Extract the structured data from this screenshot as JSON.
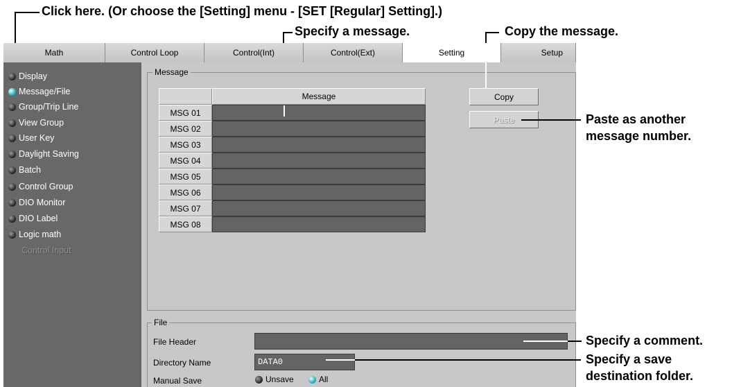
{
  "callouts": {
    "click_here": "Click here. (Or choose the [Setting] menu - [SET [Regular] Setting].)",
    "specify_message": "Specify a message.",
    "copy_message": "Copy the message.",
    "paste_line1": "Paste as another",
    "paste_line2": "message number.",
    "specify_comment": "Specify a comment.",
    "save_folder_line1": "Specify a save",
    "save_folder_line2": "destination folder."
  },
  "tabs": [
    {
      "label": "Math"
    },
    {
      "label": "Control Loop"
    },
    {
      "label": "Control(Int)"
    },
    {
      "label": "Control(Ext)"
    },
    {
      "label": "Setting",
      "active": true
    },
    {
      "label": "Setup"
    }
  ],
  "sidebar": {
    "items": [
      {
        "label": "Display",
        "selected": false
      },
      {
        "label": "Message/File",
        "selected": true
      },
      {
        "label": "Group/Trip Line",
        "selected": false
      },
      {
        "label": "View Group",
        "selected": false
      },
      {
        "label": "User Key",
        "selected": false
      },
      {
        "label": "Daylight Saving",
        "selected": false
      },
      {
        "label": "Batch",
        "selected": false
      },
      {
        "label": "Control Group",
        "selected": false
      },
      {
        "label": "DIO Monitor",
        "selected": false
      },
      {
        "label": "DIO Label",
        "selected": false
      },
      {
        "label": "Logic math",
        "selected": false
      }
    ],
    "disabled_item": "Control Input"
  },
  "message": {
    "group_label": "Message",
    "column_header": "Message",
    "rows": [
      {
        "label": "MSG 01",
        "value": ""
      },
      {
        "label": "MSG 02",
        "value": ""
      },
      {
        "label": "MSG 03",
        "value": ""
      },
      {
        "label": "MSG 04",
        "value": ""
      },
      {
        "label": "MSG 05",
        "value": ""
      },
      {
        "label": "MSG 06",
        "value": ""
      },
      {
        "label": "MSG 07",
        "value": ""
      },
      {
        "label": "MSG 08",
        "value": ""
      }
    ],
    "copy_label": "Copy",
    "paste_label": "Paste"
  },
  "file": {
    "group_label": "File",
    "header_label": "File Header",
    "header_value": "",
    "directory_label": "Directory Name",
    "directory_value": "DATA0",
    "manual_save_label": "Manual Save",
    "option_unsave": "Unsave",
    "option_all": "All",
    "selected_option": "Unsave"
  }
}
